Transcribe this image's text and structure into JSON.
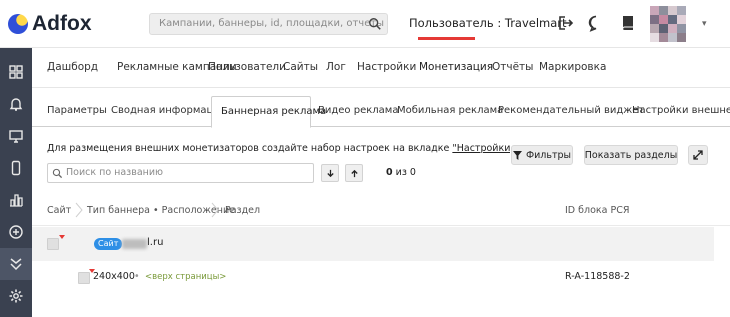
{
  "header": {
    "logo_text": "Adfox",
    "search_placeholder": "Кампании, баннеры, id, площадки, отчеты",
    "user_label": "Пользователь : Travelmart",
    "icons": [
      "logout-icon",
      "chat-icon",
      "book-icon"
    ]
  },
  "sidebar": {
    "items": [
      {
        "icon": "dashboard-icon"
      },
      {
        "icon": "bell-icon"
      },
      {
        "icon": "monitor-icon"
      },
      {
        "icon": "mobile-icon"
      },
      {
        "icon": "chart-icon"
      },
      {
        "icon": "plus-circle-icon"
      },
      {
        "icon": "monetization-icon",
        "active": true
      },
      {
        "icon": "gear-icon"
      }
    ]
  },
  "nav": {
    "items": [
      "Дашборд",
      "Рекламные кампании",
      "Пользователи",
      "Сайты",
      "Лог",
      "Настройки",
      "Монетизация",
      "Отчёты",
      "Маркировка"
    ],
    "active": "Монетизация"
  },
  "subtabs": {
    "items": [
      "Параметры",
      "Сводная информация",
      "Баннерная реклама",
      "Видео реклама",
      "Мобильная реклама",
      "Рекомендательный виджет",
      "Настройки внешней мо"
    ],
    "active": "Баннерная реклама"
  },
  "info": {
    "text": "Для размещения внешних монетизаторов создайте набор настроек на вкладке ",
    "link": "\"Настройки внешней монетизации\""
  },
  "toolbar": {
    "filters_label": "Фильтры",
    "show_sections_label": "Показать разделы",
    "search_placeholder": "Поиск по названию",
    "counter_value": "0",
    "counter_suffix": "из 0"
  },
  "table": {
    "breadcrumbs": [
      "Сайт",
      "Тип баннера • Расположение",
      "Раздел"
    ],
    "id_column": "ID блока РСЯ",
    "site_badge": "Сайт",
    "site_domain_tail": "l.ru",
    "rows": [
      {
        "size": "240x400",
        "position": "<верх страницы>",
        "id": "R-A-118588-2"
      }
    ]
  },
  "colors": {
    "accent": "#e53935",
    "sidebar": "#3a4150",
    "badge": "#2e8fe6"
  }
}
